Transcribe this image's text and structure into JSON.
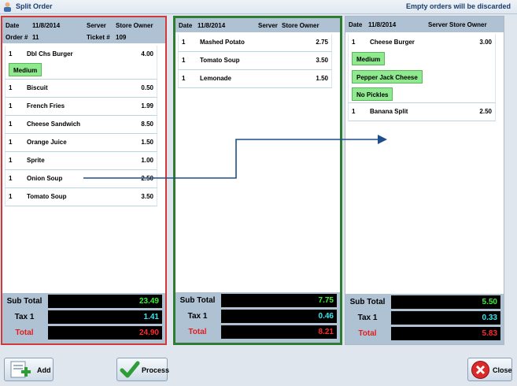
{
  "window": {
    "title": "Split Order",
    "notice": "Empty orders will be discarded"
  },
  "panels": [
    {
      "header": {
        "date_label": "Date",
        "date": "11/8/2014",
        "server_label": "Server",
        "server": "Store Owner",
        "order_label": "Order #",
        "order": "11",
        "ticket_label": "Ticket #",
        "ticket": "109"
      },
      "items": [
        {
          "qty": "1",
          "name": "Dbl Chs Burger",
          "price": "4.00",
          "modifiers": [
            "Medium"
          ]
        },
        {
          "qty": "1",
          "name": "Biscuit",
          "price": "0.50"
        },
        {
          "qty": "1",
          "name": "French Fries",
          "price": "1.99"
        },
        {
          "qty": "1",
          "name": "Cheese Sandwich",
          "price": "8.50"
        },
        {
          "qty": "1",
          "name": "Orange Juice",
          "price": "1.50"
        },
        {
          "qty": "1",
          "name": "Sprite",
          "price": "1.00"
        },
        {
          "qty": "1",
          "name": "Onion Soup",
          "price": "2.50"
        },
        {
          "qty": "1",
          "name": "Tomato Soup",
          "price": "3.50"
        }
      ],
      "totals": {
        "subtotal_label": "Sub Total",
        "subtotal": "23.49",
        "tax_label": "Tax 1",
        "tax": "1.41",
        "total_label": "Total",
        "total": "24.90"
      }
    },
    {
      "header": {
        "date_label": "Date",
        "date": "11/8/2014",
        "server_label": "Server",
        "server": "Store Owner"
      },
      "items": [
        {
          "qty": "1",
          "name": "Mashed Potato",
          "price": "2.75"
        },
        {
          "qty": "1",
          "name": "Tomato Soup",
          "price": "3.50"
        },
        {
          "qty": "1",
          "name": "Lemonade",
          "price": "1.50"
        }
      ],
      "totals": {
        "subtotal_label": "Sub Total",
        "subtotal": "7.75",
        "tax_label": "Tax 1",
        "tax": "0.46",
        "total_label": "Total",
        "total": "8.21"
      }
    },
    {
      "header": {
        "date_label": "Date",
        "date": "11/8/2014",
        "server_label": "Server",
        "server": "Store Owner"
      },
      "items": [
        {
          "qty": "1",
          "name": "Cheese Burger",
          "price": "3.00",
          "modifiers": [
            "Medium",
            "Pepper Jack Cheese",
            "No Pickles"
          ]
        },
        {
          "qty": "1",
          "name": "Banana Split",
          "price": "2.50"
        }
      ],
      "totals": {
        "subtotal_label": "Sub Total",
        "subtotal": "5.50",
        "tax_label": "Tax 1",
        "tax": "0.33",
        "total_label": "Total",
        "total": "5.83"
      }
    }
  ],
  "buttons": {
    "add": "Add",
    "process": "Process",
    "close": "Close"
  },
  "colors": {
    "subtotal": "#3cf03c",
    "tax": "#38e8f0",
    "total": "#ff2a2a",
    "panel1_border": "#d23a3a",
    "panel2_border": "#2e7d32",
    "modifier_bg": "#8fea8f",
    "arrow": "#1f4e8c"
  },
  "icons": {
    "app": "split-order-icon",
    "add": "add-order-icon",
    "process": "checkmark-icon",
    "close": "close-icon"
  }
}
